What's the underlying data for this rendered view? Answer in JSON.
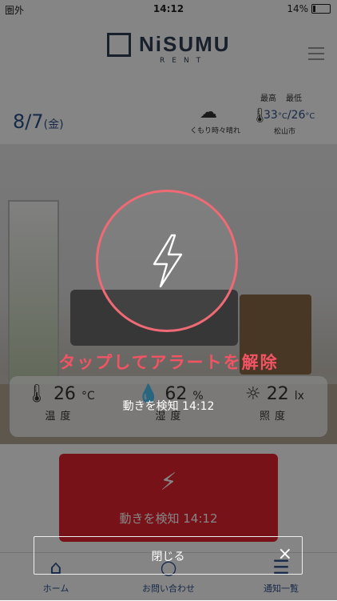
{
  "status_bar": {
    "carrier": "圏外",
    "time": "14:12",
    "battery": "14%",
    "battery_level": 0.14
  },
  "header": {
    "logo_text": "NiSUMU",
    "logo_sub": "RENT"
  },
  "info": {
    "date_main": "8/7",
    "date_day": "(金)",
    "weather_label": "くもり時々晴れ",
    "max_label": "最高",
    "min_label": "最低",
    "max_temp": "33",
    "min_temp": "26",
    "temp_unit": "°C",
    "separator": "/",
    "city": "松山市"
  },
  "sensors": [
    {
      "value": "26",
      "unit": "°C",
      "label": "温度",
      "icon": "thermometer-icon"
    },
    {
      "value": "62",
      "unit": "%",
      "label": "湿度",
      "icon": "droplet-icon"
    },
    {
      "value": "22",
      "unit": "lx",
      "label": "照度",
      "icon": "sun-icon"
    }
  ],
  "alert_button": {
    "text": "動きを検知 14:12"
  },
  "nav": {
    "items": [
      {
        "label": "ホーム",
        "icon": "home-icon"
      },
      {
        "label": "お問い合わせ",
        "icon": "contact-icon"
      },
      {
        "label": "通知一覧",
        "icon": "list-icon"
      }
    ]
  },
  "overlay": {
    "tap_text": "タップしてアラートを解除",
    "message": "動きを検知 14:12",
    "close_label": "閉じる",
    "close_icon": "×"
  },
  "colors": {
    "accent_red": "#e4232f",
    "overlay_ring": "#ef6a75",
    "brand_navy": "#2d4f8a"
  }
}
